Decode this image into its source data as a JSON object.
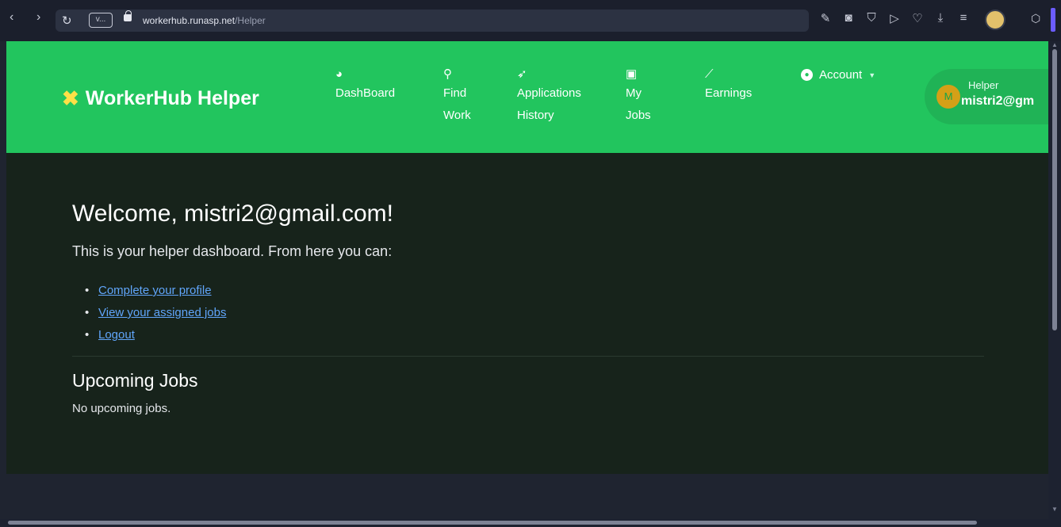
{
  "browser": {
    "url_host": "workerhub.runasp.net",
    "url_path": "/Helper",
    "tab_chip": "v..."
  },
  "navbar": {
    "brand": "WorkerHub Helper",
    "items": [
      {
        "label": "DashBoard",
        "icon": "gauge-icon"
      },
      {
        "label": "Find Work",
        "icon": "search-icon"
      },
      {
        "label": "Applications History",
        "icon": "paper-plane-icon"
      },
      {
        "label": "My Jobs",
        "icon": "calendar-check-icon"
      },
      {
        "label": "Earnings",
        "icon": "chart-line-icon"
      }
    ],
    "account_label": "Account",
    "helper": {
      "avatar_initial": "M",
      "role": "Helper",
      "email": "mistri2@gm"
    }
  },
  "main": {
    "welcome": "Welcome, mistri2@gmail.com!",
    "intro": "This is your helper dashboard. From here you can:",
    "links": [
      "Complete your profile",
      "View your assigned jobs",
      "Logout"
    ],
    "upcoming_title": "Upcoming Jobs",
    "no_jobs": "No upcoming jobs."
  },
  "colors": {
    "navbar_green": "#22c55e",
    "content_bg": "#17231b",
    "link_blue": "#60a5fa",
    "brand_icon_yellow": "#fde047"
  }
}
